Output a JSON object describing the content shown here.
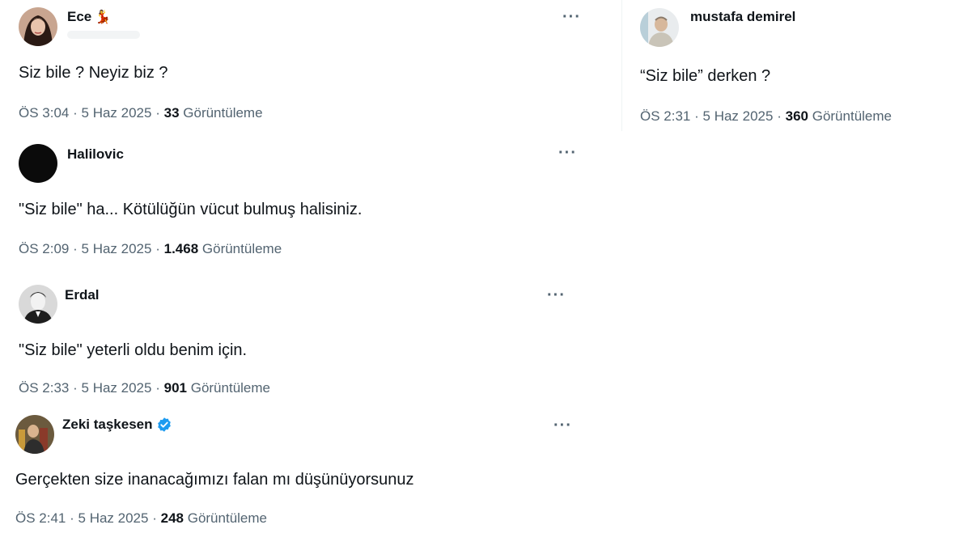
{
  "tweets": [
    {
      "name": "Ece",
      "name_emoji": "💃",
      "text": "Siz bile ? Neyiz biz ?",
      "time": "ÖS 3:04",
      "date": "5 Haz 2025",
      "views": "33",
      "views_label": "Görüntüleme",
      "more": "···"
    },
    {
      "name": "mustafa demirel",
      "text": "“Siz bile” derken ?",
      "time": "ÖS 2:31",
      "date": "5 Haz 2025",
      "views": "360",
      "views_label": "Görüntüleme"
    },
    {
      "name": "Halilovic",
      "text": "\"Siz bile\" ha... Kötülüğün vücut bulmuş halisiniz.",
      "time": "ÖS 2:09",
      "date": "5 Haz 2025",
      "views": "1.468",
      "views_label": "Görüntüleme",
      "more": "···"
    },
    {
      "name": "Erdal",
      "text": "\"Siz bile\" yeterli oldu benim için.",
      "time": "ÖS 2:33",
      "date": "5 Haz 2025",
      "views": "901",
      "views_label": "Görüntüleme",
      "more": "···"
    },
    {
      "name": "Zeki taşkesen",
      "verified": true,
      "text": "Gerçekten size inanacağımızı falan mı düşünüyorsunuz",
      "time": "ÖS 2:41",
      "date": "5 Haz 2025",
      "views": "248",
      "views_label": "Görüntüleme",
      "more": "···"
    }
  ],
  "meta_separator": "·",
  "colors": {
    "text": "#0f1419",
    "secondary": "#536471",
    "verified": "#1d9bf0"
  }
}
